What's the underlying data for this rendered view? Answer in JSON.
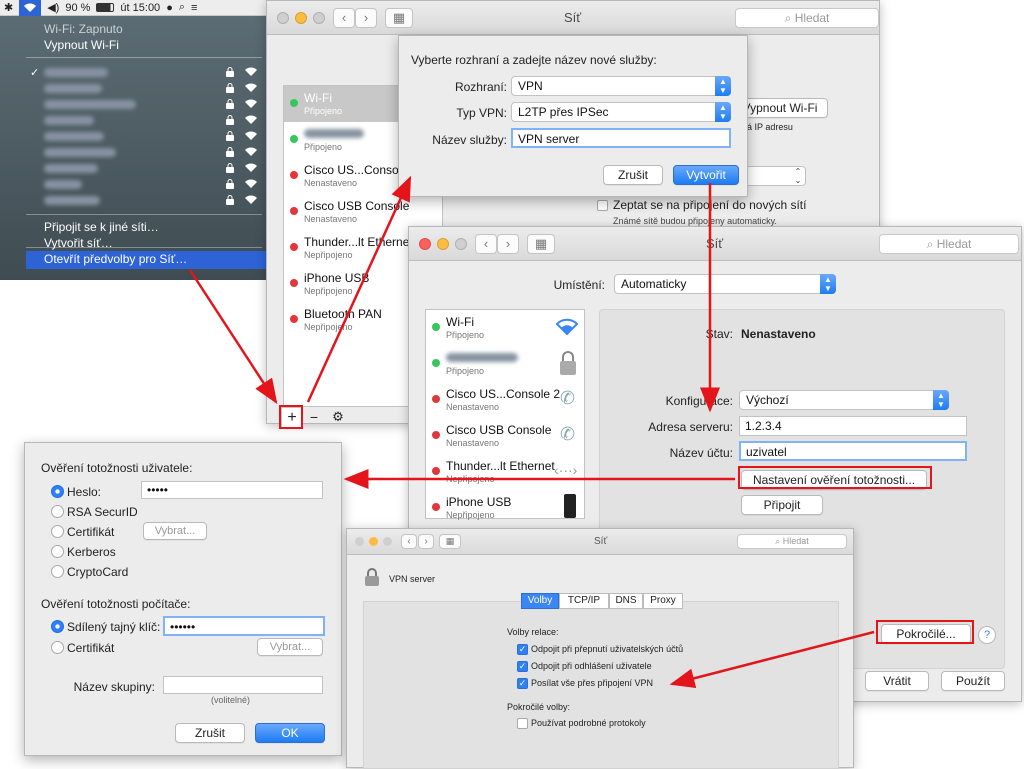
{
  "menubar": {
    "battery": "90 %",
    "clock": "út 15:00"
  },
  "wifi_menu": {
    "status": "Wi-Fi: Zapnuto",
    "toggle": "Vypnout Wi-Fi",
    "join_other": "Připojit se k jiné síti…",
    "create": "Vytvořit síť…",
    "open_prefs": "Otevřít předvolby pro Síť…"
  },
  "bg_window": {
    "title": "Síť",
    "search": "Hledat",
    "services": [
      {
        "name": "Wi-Fi",
        "status": "Připojeno",
        "color": "green"
      },
      {
        "name": "",
        "status": "Připojeno",
        "color": "green"
      },
      {
        "name": "Cisco US...Console",
        "status": "Nenastaveno",
        "color": "red"
      },
      {
        "name": "Cisco USB Console",
        "status": "Nenastaveno",
        "color": "red"
      },
      {
        "name": "Thunder...lt Ethernet",
        "status": "Nepřipojeno",
        "color": "red"
      },
      {
        "name": "iPhone USB",
        "status": "Nepřipojeno",
        "color": "red"
      },
      {
        "name": "Bluetooth PAN",
        "status": "Nepřipojeno",
        "color": "red"
      }
    ],
    "add": "+",
    "remove": "−",
    "gear": "⚙",
    "turn_off_wifi": "Vypnout Wi-Fi",
    "ip_note": "a má IP adresu",
    "ask_join": "Zeptat se na připojení do nových sítí",
    "known_note": "Známé sítě budou připojeny automaticky."
  },
  "new_service_sheet": {
    "heading": "Vyberte rozhraní a zadejte název nové služby:",
    "interface_label": "Rozhraní:",
    "interface_value": "VPN",
    "vpn_type_label": "Typ VPN:",
    "vpn_type_value": "L2TP přes IPSec",
    "service_name_label": "Název služby:",
    "service_name_value": "VPN server",
    "cancel": "Zrušit",
    "create": "Vytvořit"
  },
  "vpn_window": {
    "title": "Síť",
    "search": "Hledat",
    "location_label": "Umístění:",
    "location_value": "Automaticky",
    "services": [
      {
        "name": "Wi-Fi",
        "status": "Připojeno",
        "color": "green"
      },
      {
        "name": "",
        "status": "Připojeno",
        "color": "green"
      },
      {
        "name": "Cisco US...Console 2",
        "status": "Nenastaveno",
        "color": "red"
      },
      {
        "name": "Cisco USB Console",
        "status": "Nenastaveno",
        "color": "red"
      },
      {
        "name": "Thunder...lt Ethernet",
        "status": "Nepřipojeno",
        "color": "red"
      },
      {
        "name": "iPhone USB",
        "status": "Nepřipojeno",
        "color": "red"
      }
    ],
    "status_label": "Stav:",
    "status_value": "Nenastaveno",
    "config_label": "Konfigurace:",
    "config_value": "Výchozí",
    "server_label": "Adresa serveru:",
    "server_value": "1.2.3.4",
    "account_label": "Název účtu:",
    "account_value": "uzivatel",
    "auth_settings": "Nastavení ověření totožnosti...",
    "connect": "Připojit",
    "advanced": "Pokročilé...",
    "help": "?",
    "revert": "Vrátit",
    "apply": "Použít"
  },
  "auth_dialog": {
    "user_heading": "Ověření totožnosti uživatele:",
    "password_label": "Heslo:",
    "password_value": "•••••",
    "rsa": "RSA SecurID",
    "certificate": "Certifikát",
    "choose": "Vybrat...",
    "kerberos": "Kerberos",
    "cryptocard": "CryptoCard",
    "machine_heading": "Ověření totožnosti počítače:",
    "shared_secret_label": "Sdílený tajný klíč:",
    "shared_secret_value": "••••••",
    "certificate2": "Certifikát",
    "choose2": "Vybrat...",
    "group_label": "Název skupiny:",
    "optional": "(volitelné)",
    "cancel": "Zrušit",
    "ok": "OK"
  },
  "advanced_window": {
    "title": "Síť",
    "search": "Hledat",
    "service": "VPN server",
    "tabs": [
      "Volby",
      "TCP/IP",
      "DNS",
      "Proxy"
    ],
    "session_heading": "Volby relace:",
    "opt1": "Odpojit při přepnutí uživatelských účtů",
    "opt2": "Odpojit při odhlášení uživatele",
    "opt3": "Posílat vše přes připojení VPN",
    "advanced_heading": "Pokročilé volby:",
    "opt4": "Používat podrobné protokoly"
  },
  "colors": {
    "accent": "#2e63d6",
    "arrow": "#e3151b"
  }
}
